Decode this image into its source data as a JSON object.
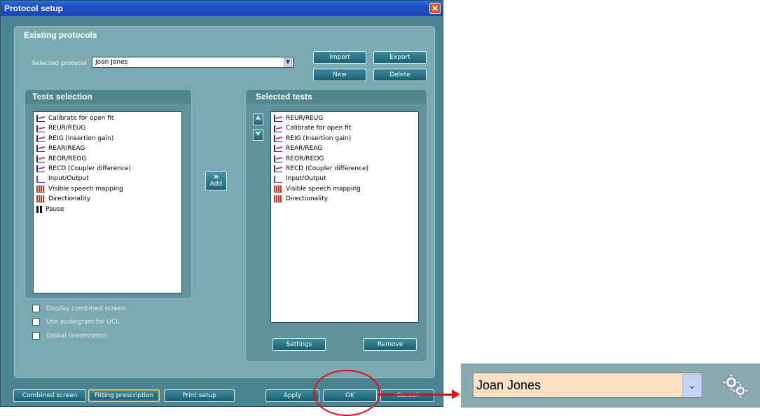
{
  "window": {
    "title": "Protocol setup",
    "close_icon": "close-icon"
  },
  "existing_protocols": {
    "header": "Existing protocols",
    "selected_label": "Selected protocol",
    "selected_value": "Joan Jones",
    "buttons": {
      "import": "Import",
      "export": "Export",
      "new": "New",
      "delete": "Delete"
    }
  },
  "tests_selection": {
    "header": "Tests selection",
    "items": [
      {
        "label": "Calibrate for open fit",
        "icon": "curve-icon"
      },
      {
        "label": "REUR/REUG",
        "icon": "curve-icon"
      },
      {
        "label": "REIG (Insertion gain)",
        "icon": "curve-icon"
      },
      {
        "label": "REAR/REAG",
        "icon": "curve-icon"
      },
      {
        "label": "REOR/REOG",
        "icon": "curve-icon"
      },
      {
        "label": "RECD (Coupler difference)",
        "icon": "curve-icon"
      },
      {
        "label": "Input/Output",
        "icon": "io-curve-icon"
      },
      {
        "label": "Visible speech mapping",
        "icon": "bars-icon"
      },
      {
        "label": "Directionality",
        "icon": "bars-icon"
      },
      {
        "label": "Pause",
        "icon": "pause-icon"
      }
    ]
  },
  "add_button": {
    "line1": "»",
    "line2": "Add"
  },
  "selected_tests": {
    "header": "Selected tests",
    "items": [
      {
        "label": "REUR/REUG",
        "icon": "curve-icon"
      },
      {
        "label": "Calibrate for open fit",
        "icon": "curve-icon"
      },
      {
        "label": "REIG (Insertion gain)",
        "icon": "curve-icon"
      },
      {
        "label": "REAR/REAG",
        "icon": "curve-icon"
      },
      {
        "label": "REOR/REOG",
        "icon": "curve-icon"
      },
      {
        "label": "RECD (Coupler difference)",
        "icon": "curve-icon"
      },
      {
        "label": "Input/Output",
        "icon": "io-curve-icon"
      },
      {
        "label": "Visible speech mapping",
        "icon": "bars-icon"
      },
      {
        "label": "Directionality",
        "icon": "bars-icon"
      }
    ],
    "move_up": "⮝",
    "move_down": "⮟",
    "buttons": {
      "settings": "Settings",
      "remove": "Remove"
    }
  },
  "checkboxes": [
    {
      "label": "Display combined screen",
      "checked": false
    },
    {
      "label": "Use audiogram for UCL",
      "checked": false
    },
    {
      "label": "Global linearization",
      "checked": false
    }
  ],
  "footer": {
    "combined_screen": "Combined screen",
    "fitting_prescription": "Fitting prescription",
    "print_setup": "Print setup",
    "apply": "Apply",
    "ok": "OK",
    "cancel": "Cancel"
  },
  "zoom_callout": {
    "value": "Joan Jones",
    "gear_icon": "gear-icon"
  },
  "colors": {
    "highlight": "#e0101a",
    "dialog_bg": "#4c8591",
    "title_bar": "#1d4fc4"
  }
}
